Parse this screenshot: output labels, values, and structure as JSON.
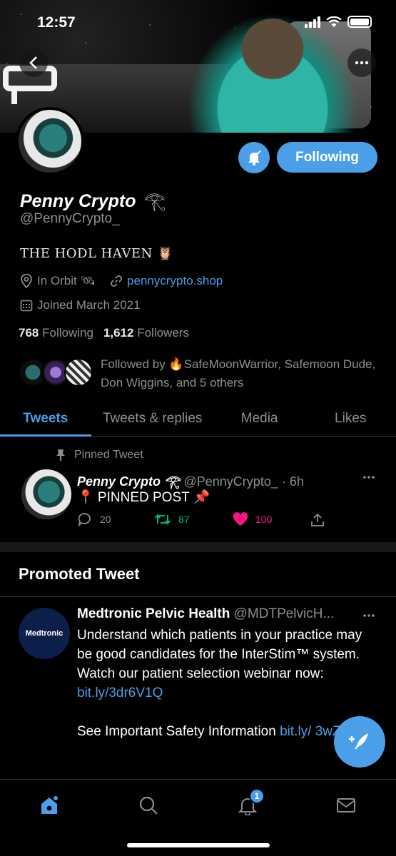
{
  "status_bar": {
    "time": "12:57"
  },
  "profile": {
    "name": "Penny Crypto",
    "name_emoji": "𓂀",
    "handle": "@PennyCrypto_",
    "bio": "THE HODL HAVEN 🦉",
    "location": "In Orbit 🛰",
    "website": "pennycrypto.shop",
    "joined": "Joined March 2021",
    "following_count": "768",
    "following_label": "Following",
    "followers_count": "1,612",
    "followers_label": "Followers",
    "followed_by": "Followed by 🔥SafeMoonWarrior, Safemoon Dude, Don Wiggins, and 5 others",
    "follow_button": "Following"
  },
  "tabs": [
    {
      "label": "Tweets",
      "active": true
    },
    {
      "label": "Tweets & replies",
      "active": false
    },
    {
      "label": "Media",
      "active": false
    },
    {
      "label": "Likes",
      "active": false
    }
  ],
  "pinned_tweet": {
    "label": "Pinned Tweet",
    "author": "Penny Crypto 𓂀",
    "handle_time": "@PennyCrypto_ · 6h",
    "text": "📍 PINNED POST 📌",
    "replies": "20",
    "retweets": "87",
    "likes": "100"
  },
  "promoted": {
    "section_title": "Promoted Tweet",
    "author": "Medtronic Pelvic Health",
    "handle": "@MDTPelvicH...",
    "avatar_text": "Medtronic",
    "text_1": "Understand which patients in your practice may be good candidates for the InterStim™ system. Watch our patient selection webinar now: ",
    "link_1": "bit.ly/3dr6V1Q",
    "text_2": "See Important Safety Information ",
    "link_2": "bit.ly/ 3wZL09H"
  },
  "nav": {
    "notifications_badge": "1"
  },
  "colors": {
    "accent": "#4a9fe8",
    "like": "#f91880",
    "retweet": "#00ba7c"
  }
}
